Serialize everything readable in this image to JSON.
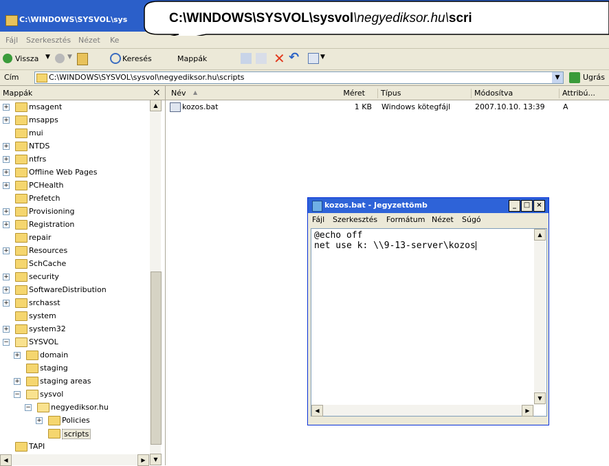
{
  "window": {
    "title": "C:\\WINDOWS\\SYSVOL\\sys"
  },
  "callout": {
    "prefix": "C:\\WINDOWS\\SYSVOL\\sysvol",
    "italic": "\\negyediksor.hu\\",
    "suffix": "scri"
  },
  "menu": [
    "Fájl",
    "Szerkesztés",
    "Nézet",
    "Ke"
  ],
  "toolbar": {
    "back": "Vissza",
    "search": "Keresés",
    "folders": "Mappák"
  },
  "address": {
    "label": "Cím",
    "path": "C:\\WINDOWS\\SYSVOL\\sysvol\\negyediksor.hu\\scripts",
    "go": "Ugrás"
  },
  "folders": {
    "header": "Mappák",
    "close": "×",
    "items": [
      {
        "label": "msagent",
        "exp": "+"
      },
      {
        "label": "msapps",
        "exp": "+"
      },
      {
        "label": "mui",
        "exp": ""
      },
      {
        "label": "NTDS",
        "exp": "+"
      },
      {
        "label": "ntfrs",
        "exp": "+"
      },
      {
        "label": "Offline Web Pages",
        "exp": "+"
      },
      {
        "label": "PCHealth",
        "exp": "+"
      },
      {
        "label": "Prefetch",
        "exp": ""
      },
      {
        "label": "Provisioning",
        "exp": "+"
      },
      {
        "label": "Registration",
        "exp": "+"
      },
      {
        "label": "repair",
        "exp": ""
      },
      {
        "label": "Resources",
        "exp": "+"
      },
      {
        "label": "SchCache",
        "exp": ""
      },
      {
        "label": "security",
        "exp": "+"
      },
      {
        "label": "SoftwareDistribution",
        "exp": "+"
      },
      {
        "label": "srchasst",
        "exp": "+"
      },
      {
        "label": "system",
        "exp": ""
      },
      {
        "label": "system32",
        "exp": "+"
      },
      {
        "label": "SYSVOL",
        "exp": "−"
      },
      {
        "label": "domain",
        "exp": "+"
      },
      {
        "label": "staging",
        "exp": ""
      },
      {
        "label": "staging areas",
        "exp": "+"
      },
      {
        "label": "sysvol",
        "exp": "−"
      },
      {
        "label": "negyediksor.hu",
        "exp": "−"
      },
      {
        "label": "Policies",
        "exp": "+"
      },
      {
        "label": "scripts",
        "exp": ""
      },
      {
        "label": "TAPI",
        "exp": ""
      }
    ]
  },
  "list": {
    "columns": [
      "Név",
      "Méret",
      "Típus",
      "Módosítva",
      "Attribú..."
    ],
    "rows": [
      {
        "name": "kozos.bat",
        "size": "1 KB",
        "type": "Windows kötegfájl",
        "modified": "2007.10.10. 13:39",
        "attr": "A"
      }
    ]
  },
  "notepad": {
    "title": "kozos.bat - Jegyzettömb",
    "menu": [
      "Fájl",
      "Szerkesztés",
      "Formátum",
      "Nézet",
      "Súgó"
    ],
    "lines": [
      "@echo off",
      "net use k: \\\\9-13-server\\kozos"
    ]
  }
}
